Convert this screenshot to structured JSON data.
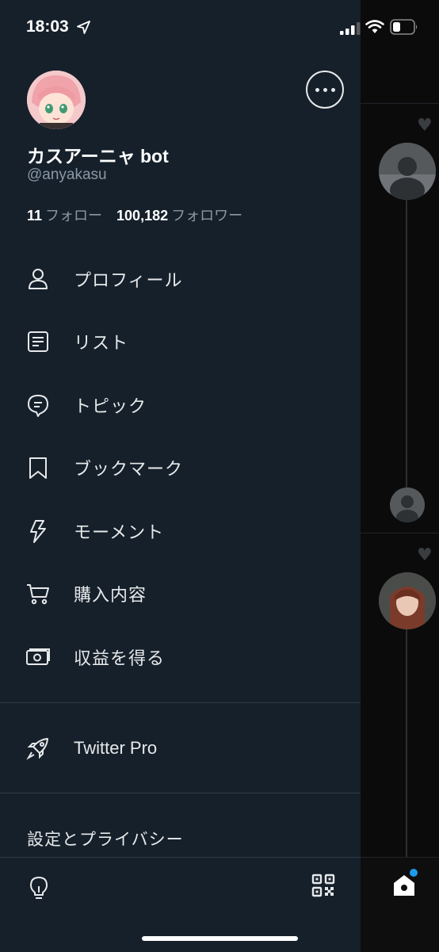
{
  "status_bar": {
    "time": "18:03"
  },
  "profile": {
    "display_name": "カスアーニャ bot",
    "handle": "@anyakasu",
    "following_count": "11",
    "following_label": "フォロー",
    "followers_count": "100,182",
    "followers_label": "フォロワー"
  },
  "menu": {
    "items": [
      {
        "label": "プロフィール",
        "icon": "person-icon"
      },
      {
        "label": "リスト",
        "icon": "list-icon"
      },
      {
        "label": "トピック",
        "icon": "topic-icon"
      },
      {
        "label": "ブックマーク",
        "icon": "bookmark-icon"
      },
      {
        "label": "モーメント",
        "icon": "lightning-icon"
      },
      {
        "label": "購入内容",
        "icon": "cart-icon"
      },
      {
        "label": "収益を得る",
        "icon": "money-icon"
      }
    ],
    "pro": {
      "label": "Twitter Pro",
      "icon": "rocket-icon"
    },
    "settings_label": "設定とプライバシー"
  },
  "colors": {
    "drawer_bg": "#15202b",
    "text": "#e7e9ea",
    "secondary_text": "#8b98a5",
    "accent": "#1d9bf0"
  }
}
